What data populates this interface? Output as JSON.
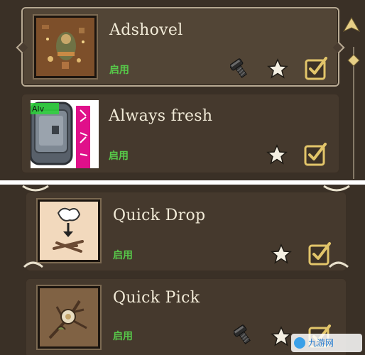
{
  "mods": [
    {
      "title": "Adshovel",
      "status": "启用",
      "has_server_icon": true,
      "favorite_icon": "star-icon",
      "enabled_icon": "checkbox-checked-icon",
      "selected": true
    },
    {
      "title": "Always fresh",
      "status": "启用",
      "has_server_icon": false,
      "favorite_icon": "star-icon",
      "enabled_icon": "checkbox-checked-icon",
      "selected": false
    },
    {
      "title": "Quick Drop",
      "status": "启用",
      "has_server_icon": false,
      "favorite_icon": "star-icon",
      "enabled_icon": "checkbox-checked-icon",
      "selected": false
    },
    {
      "title": "Quick Pick",
      "status": "启用",
      "has_server_icon": true,
      "favorite_icon": "star-icon",
      "enabled_icon": "checkbox-checked-icon",
      "selected": false
    }
  ],
  "thumb_overlay_text": "Alv",
  "watermark": "九游网",
  "colors": {
    "panel_bg": "#3a3026",
    "card_bg": "#4a3d31",
    "title_text": "#f1ead7",
    "status_green": "#57c94a",
    "checkbox_gold": "#e2c56a",
    "star_white": "#f4efe2"
  }
}
